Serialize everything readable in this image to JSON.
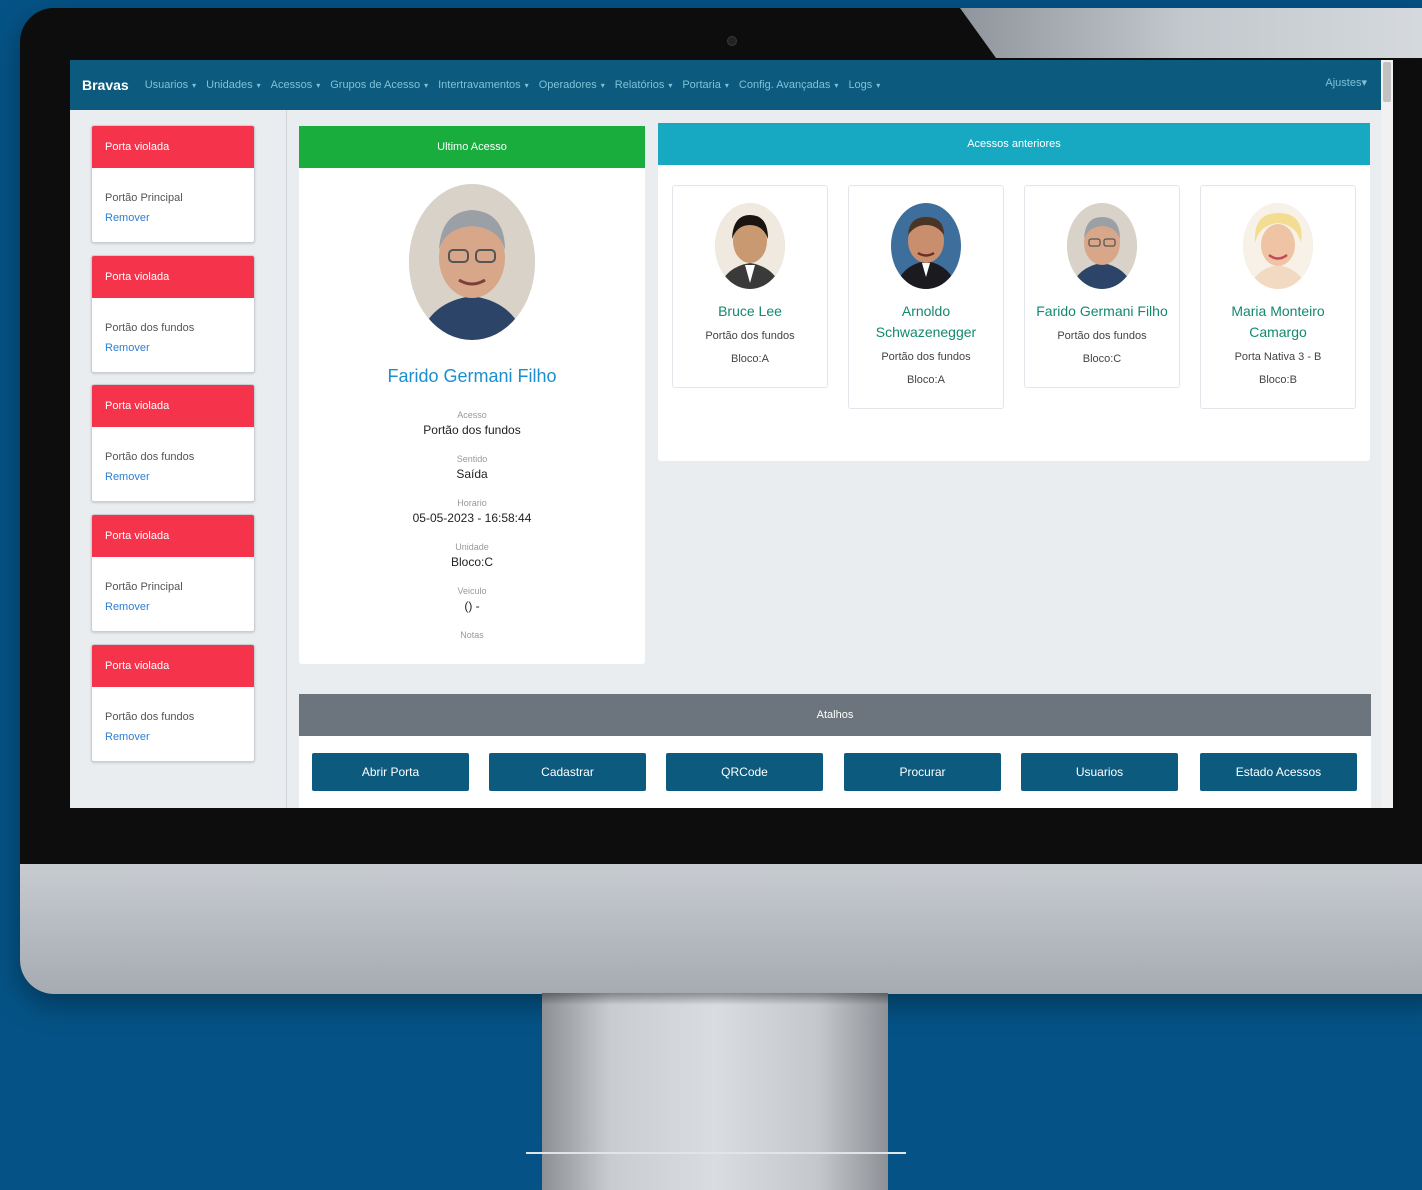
{
  "navbar": {
    "brand": "Bravas",
    "items": [
      {
        "label": "Usuarios"
      },
      {
        "label": "Unidades"
      },
      {
        "label": "Acessos"
      },
      {
        "label": "Grupos de Acesso"
      },
      {
        "label": "Intertravamentos"
      },
      {
        "label": "Operadores"
      },
      {
        "label": "Relatórios"
      },
      {
        "label": "Portaria"
      },
      {
        "label": "Config. Avançadas"
      },
      {
        "label": "Logs"
      }
    ],
    "settings": "Ajustes",
    "caret": "▾"
  },
  "alerts": [
    {
      "title": "Porta violada",
      "place": "Portão Principal",
      "action": "Remover"
    },
    {
      "title": "Porta violada",
      "place": "Portão dos fundos",
      "action": "Remover"
    },
    {
      "title": "Porta violada",
      "place": "Portão dos fundos",
      "action": "Remover"
    },
    {
      "title": "Porta violada",
      "place": "Portão Principal",
      "action": "Remover"
    },
    {
      "title": "Porta violada",
      "place": "Portão dos fundos",
      "action": "Remover"
    }
  ],
  "last_access": {
    "header": "Ultimo Acesso",
    "name": "Farido Germani Filho",
    "fields": {
      "acesso": {
        "label": "Acesso",
        "value": "Portão dos fundos"
      },
      "sentido": {
        "label": "Sentido",
        "value": "Saída"
      },
      "horario": {
        "label": "Horario",
        "value": "05-05-2023 - 16:58:44"
      },
      "unidade": {
        "label": "Unidade",
        "value": "Bloco:C"
      },
      "veiculo": {
        "label": "Veiculo",
        "value": "() -"
      },
      "notas": {
        "label": "Notas",
        "value": ""
      }
    }
  },
  "previous_access": {
    "header": "Acessos anteriores",
    "people": [
      {
        "name": "Bruce Lee",
        "place": "Portão dos fundos",
        "block": "Bloco:A"
      },
      {
        "name": "Arnoldo Schwazenegger",
        "place": "Portão dos fundos",
        "block": "Bloco:A"
      },
      {
        "name": "Farido Germani Filho",
        "place": "Portão dos fundos",
        "block": "Bloco:C"
      },
      {
        "name": "Maria Monteiro Camargo",
        "place": "Porta Nativa 3 - B",
        "block": "Bloco:B"
      }
    ]
  },
  "shortcuts": {
    "header": "Atalhos",
    "buttons": [
      "Abrir Porta",
      "Cadastrar",
      "QRCode",
      "Procurar",
      "Usuarios",
      "Estado Acessos"
    ]
  },
  "colors": {
    "background": "#055386",
    "navbar": "#0c5b7f",
    "alert": "#f5334a",
    "last_access_header": "#18ad3d",
    "previous_header": "#17a9c2",
    "shortcut_header": "#6c757d",
    "person_name": "#128a6d",
    "main_name": "#1b8fd1"
  }
}
